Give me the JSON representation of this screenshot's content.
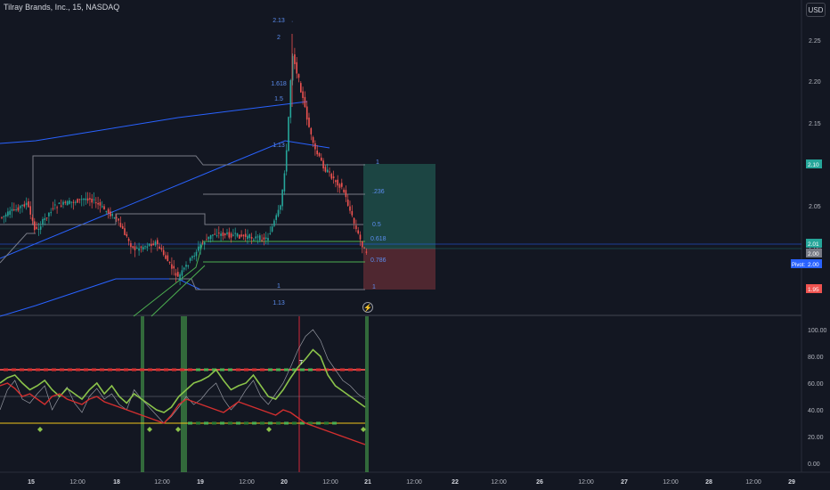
{
  "header": {
    "title": "Tilray Brands, Inc., 15, NASDAQ",
    "currency": "USD",
    "lightning_icon": "lightning-icon"
  },
  "colors": {
    "background": "#131722",
    "up": "#26a69a",
    "down": "#ef5350",
    "fib": "#2962ff",
    "channel": "#787b86",
    "green_band": "#4caf50",
    "target_zone": "#1e4d49",
    "stop_zone": "#5b2a33"
  },
  "price_axis": {
    "ticks": [
      "2.25",
      "2.20",
      "2.15",
      "2.10",
      "2.05",
      "2.00",
      "1.95"
    ],
    "badges": [
      {
        "label": "2.10",
        "color": "#26a69a"
      },
      {
        "label": "2.01",
        "color": "#26a69a"
      },
      {
        "label": "2.00",
        "color": "#787b86"
      },
      {
        "label": "2.00",
        "color": "#2962ff"
      },
      {
        "label": "1.95",
        "color": "#ef5350"
      }
    ],
    "pivot_label": "Pivot:"
  },
  "osc_axis": {
    "ticks": [
      "100.00",
      "80.00",
      "60.00",
      "40.00",
      "20.00",
      "0.00"
    ]
  },
  "time_axis": {
    "labels": [
      "15",
      "12:00",
      "18",
      "12:00",
      "19",
      "12:00",
      "20",
      "12:00",
      "21",
      "12:00",
      "22",
      "12:00",
      "26",
      "12:00",
      "27",
      "12:00",
      "28",
      "12:00",
      "29"
    ]
  },
  "fib_labels": {
    "left": [
      "2.13",
      "2",
      "1.618",
      "1.5",
      "1.13",
      "1",
      "1.13"
    ],
    "right": [
      "1",
      ".236",
      "0.5",
      "0.618",
      "0.786",
      "1"
    ]
  },
  "oscillator_marker": "T"
}
